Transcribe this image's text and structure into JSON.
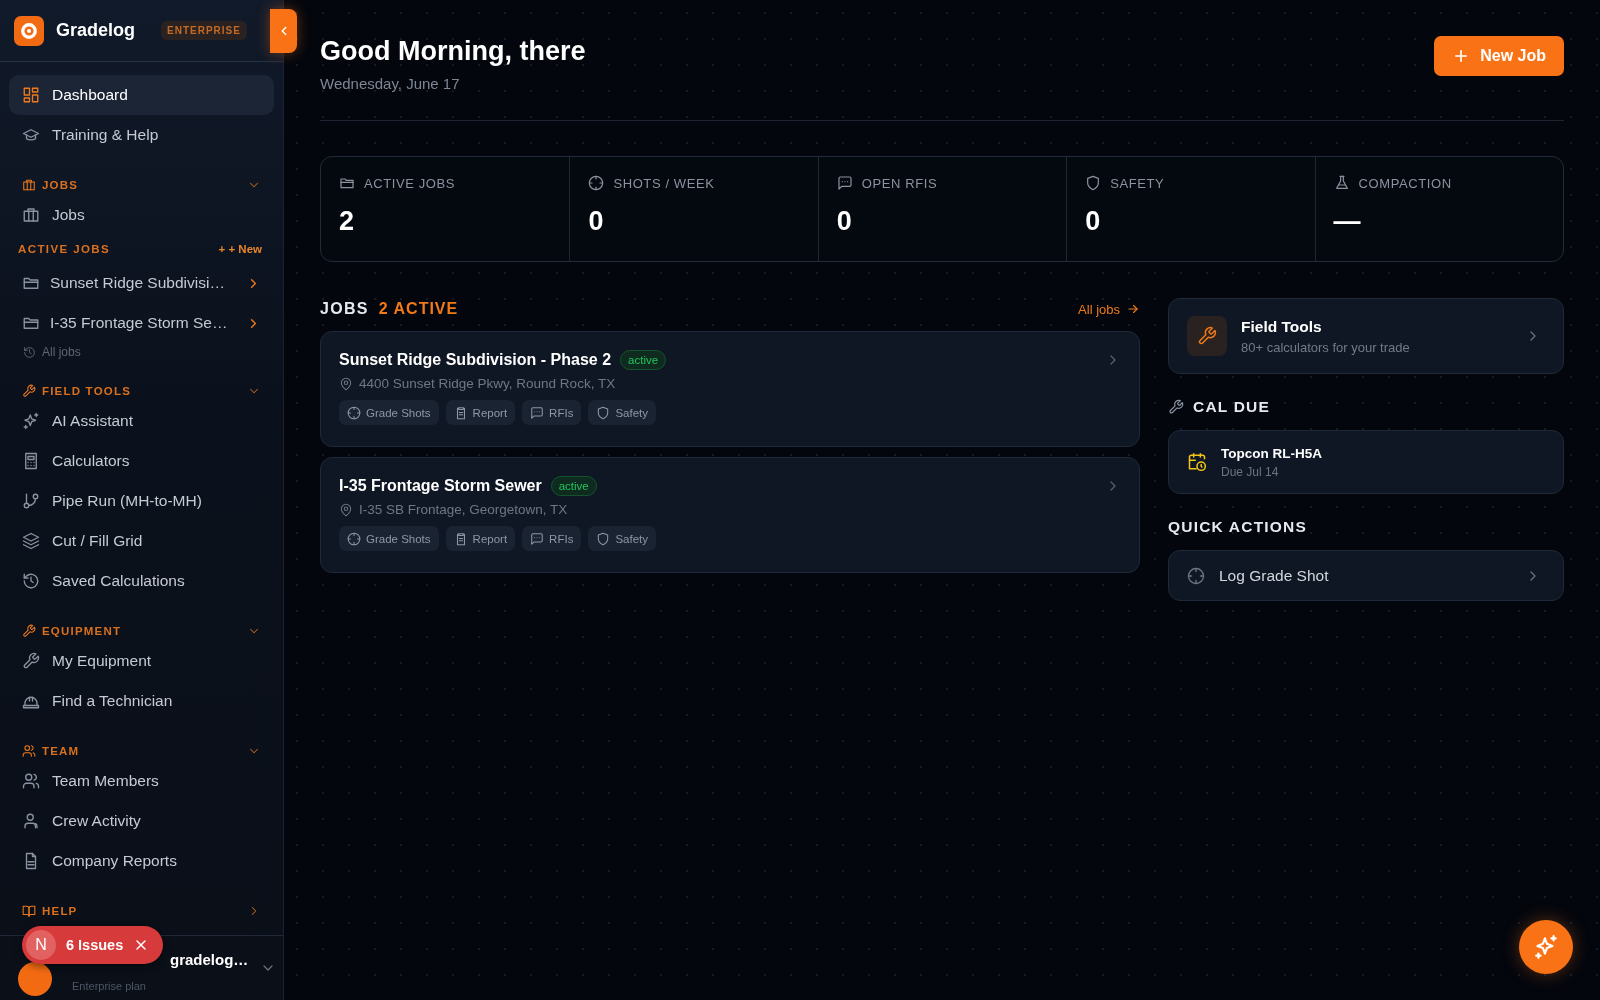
{
  "brand": {
    "name": "Gradelog",
    "badge": "ENTERPRISE"
  },
  "nav": [
    {
      "label": "Dashboard",
      "selected": true
    },
    {
      "label": "Training & Help",
      "selected": false
    }
  ],
  "sections": [
    {
      "title": "JOBS",
      "expanded": true,
      "items": [
        {
          "label": "Jobs",
          "selected": false
        }
      ],
      "subsection": {
        "title": "ACTIVE JOBS",
        "action": "+ + New",
        "items": [
          {
            "label": "Sunset Ridge Subdivisi…",
            "selected": false
          },
          {
            "label": "I-35 Frontage Storm Se…",
            "selected": false
          }
        ],
        "footer_link": "All jobs"
      }
    },
    {
      "title": "FIELD TOOLS",
      "expanded": true,
      "items": [
        {
          "label": "AI Assistant",
          "selected": false
        },
        {
          "label": "Calculators",
          "selected": false
        },
        {
          "label": "Pipe Run (MH-to-MH)",
          "selected": false
        },
        {
          "label": "Cut / Fill Grid",
          "selected": false
        },
        {
          "label": "Saved Calculations",
          "selected": false
        }
      ]
    },
    {
      "title": "EQUIPMENT",
      "expanded": true,
      "items": [
        {
          "label": "My Equipment",
          "selected": false
        },
        {
          "label": "Find a Technician",
          "selected": false
        }
      ]
    },
    {
      "title": "TEAM",
      "expanded": true,
      "items": [
        {
          "label": "Team Members",
          "selected": false
        },
        {
          "label": "Crew Activity",
          "selected": false
        },
        {
          "label": "Company Reports",
          "selected": false
        }
      ]
    },
    {
      "title": "HELP",
      "expanded": false
    }
  ],
  "user": {
    "name": "gradelog…",
    "plan": "Enterprise plan"
  },
  "issues_badge": {
    "letter": "N",
    "label": "6 Issues"
  },
  "header": {
    "greeting": "Good Morning, there",
    "date": "Wednesday, June 17",
    "new_job_button": "New Job"
  },
  "stats": [
    {
      "label": "ACTIVE JOBS",
      "value": "2"
    },
    {
      "label": "SHOTS / WEEK",
      "value": "0"
    },
    {
      "label": "OPEN RFIS",
      "value": "0"
    },
    {
      "label": "SAFETY",
      "value": "0"
    },
    {
      "label": "COMPACTION",
      "value": "—"
    }
  ],
  "jobs": {
    "title": "JOBS",
    "count": "2 ACTIVE",
    "link": "All jobs",
    "items": [
      {
        "name": "Sunset Ridge Subdivision - Phase 2",
        "status": "active",
        "address": "4400 Sunset Ridge Pkwy, Round Rock, TX",
        "actions": [
          "Grade Shots",
          "Report",
          "RFIs",
          "Safety"
        ]
      },
      {
        "name": "I-35 Frontage Storm Sewer",
        "status": "active",
        "address": "I-35 SB Frontage, Georgetown, TX",
        "actions": [
          "Grade Shots",
          "Report",
          "RFIs",
          "Safety"
        ]
      }
    ]
  },
  "field_tools": {
    "title": "Field Tools",
    "subtitle": "80+ calculators for your trade"
  },
  "cal_due": {
    "title": "CAL DUE",
    "items": [
      {
        "name": "Topcon RL-H5A",
        "due": "Due Jul 14"
      }
    ]
  },
  "quick_actions": {
    "title": "QUICK ACTIONS",
    "items": [
      {
        "label": "Log Grade Shot"
      }
    ]
  }
}
